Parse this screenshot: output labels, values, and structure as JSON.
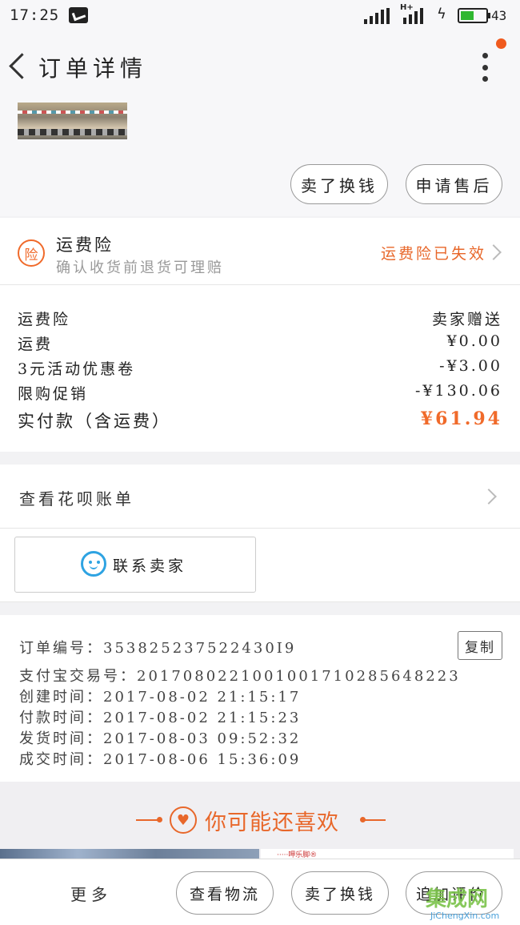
{
  "status_bar": {
    "time": "17:25",
    "network": "H+",
    "battery": "43"
  },
  "nav": {
    "title": "订单详情"
  },
  "product": {
    "thumb_caption": ""
  },
  "top_actions": {
    "sell_label": "卖了换钱",
    "aftersale_label": "申请售后"
  },
  "insurance": {
    "icon": "险",
    "title": "运费险",
    "subtitle": "确认收货前退货可理赔",
    "status": "运费险已失效"
  },
  "price": {
    "rows": [
      {
        "label": "运费险",
        "value": "卖家赠送"
      },
      {
        "label": "运费",
        "value": "¥0.00"
      },
      {
        "label": "3元活动优惠卷",
        "value": "-¥3.00"
      },
      {
        "label": "限购促销",
        "value": "-¥130.06"
      }
    ],
    "total_label": "实付款（含运费）",
    "total_value": "¥61.94",
    "total_color": "#f06a2a"
  },
  "huabei": {
    "label": "查看花呗账单"
  },
  "contact": {
    "label": "联系卖家"
  },
  "order_info": {
    "order_no": "订单编号：353825237522430I9",
    "alipay_no": "支付宝交易号：2017080221001001710285648223",
    "created": "创建时间：2017-08-02 21:15:17",
    "paid": "付款时间：2017-08-02 21:15:23",
    "shipped": "发货时间：2017-08-03 09:52:32",
    "completed": "成交时间：2017-08-06 15:36:09",
    "copy_label": "复制"
  },
  "recommend": {
    "heart": "♥",
    "title": "你可能还喜欢",
    "item2_text": "·····呷乐脚®"
  },
  "bottom": {
    "more": "更多",
    "logistics": "查看物流",
    "sell": "卖了换钱",
    "review": "追加评价"
  },
  "watermark": {
    "chars": "集成网",
    "url": "JiChengXin.com"
  },
  "colors": {
    "accent": "#e8672a",
    "blue": "#2ea3e2"
  }
}
